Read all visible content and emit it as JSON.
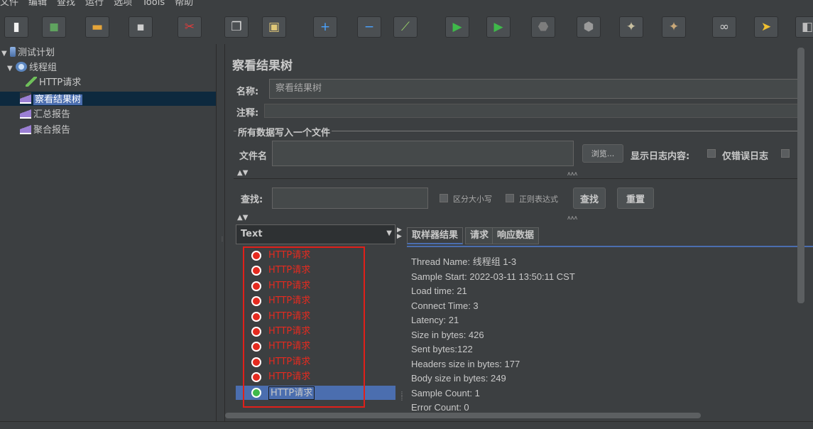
{
  "menu": [
    "文件",
    "编辑",
    "查找",
    "运行",
    "选项",
    "Tools",
    "帮助"
  ],
  "toolbar": {
    "buttons": [
      {
        "name": "new-icon",
        "glyph": "▮",
        "color": "#f2f2f2"
      },
      {
        "name": "templates-icon",
        "glyph": "◼",
        "color": "#5fa35f"
      },
      {
        "name": "open-icon",
        "glyph": "▬",
        "color": "#e5a53a"
      },
      {
        "name": "save-icon",
        "glyph": "▪",
        "color": "#d0d0d0"
      },
      {
        "name": "cut-icon",
        "glyph": "✂",
        "color": "#e03b3b"
      },
      {
        "name": "copy-icon",
        "glyph": "❐",
        "color": "#d8d8d8"
      },
      {
        "name": "paste-icon",
        "glyph": "▣",
        "color": "#e0c878"
      },
      {
        "name": "expand-icon",
        "glyph": "+",
        "color": "#4aa3ff"
      },
      {
        "name": "collapse-icon",
        "glyph": "−",
        "color": "#4aa3ff"
      },
      {
        "name": "toggle-icon",
        "glyph": "⟋",
        "color": "#9ad36a"
      },
      {
        "name": "start-icon",
        "glyph": "▶",
        "color": "#3fb94a"
      },
      {
        "name": "start-no-pauses-icon",
        "glyph": "▶",
        "color": "#3fb94a"
      },
      {
        "name": "stop-icon",
        "glyph": "⬣",
        "color": "#7d7d7d"
      },
      {
        "name": "shutdown-icon",
        "glyph": "⬢",
        "color": "#9a9a9a"
      },
      {
        "name": "clear-icon",
        "glyph": "✦",
        "color": "#c9c0a0"
      },
      {
        "name": "clear-all-icon",
        "glyph": "✦",
        "color": "#c9a878"
      },
      {
        "name": "search-binoculars-icon",
        "glyph": "∞",
        "color": "#d0d0d0"
      },
      {
        "name": "reset-search-icon",
        "glyph": "➤",
        "color": "#f0c030"
      },
      {
        "name": "function-helper-icon",
        "glyph": "◧",
        "color": "#bdbdbd"
      }
    ]
  },
  "tree": {
    "nodes": [
      {
        "label": "测试计划",
        "name": "tree-node-test-plan"
      },
      {
        "label": "线程组",
        "name": "tree-node-thread-group"
      },
      {
        "label": "HTTP请求",
        "name": "tree-node-http-request"
      },
      {
        "label": "察看结果树",
        "name": "tree-node-view-results-tree"
      },
      {
        "label": "汇总报告",
        "name": "tree-node-summary-report"
      },
      {
        "label": "聚合报告",
        "name": "tree-node-aggregate-report"
      }
    ]
  },
  "panel": {
    "title": "察看结果树",
    "name_label": "名称:",
    "name_value": "察看结果树",
    "comment_label": "注释:",
    "file_group_title": "所有数据写入一个文件",
    "filename_label": "文件名",
    "browse_button": "浏览...",
    "log_content_label": "显示日志内容:",
    "errors_only_label": "仅错误日志",
    "search_label": "查找:",
    "case_sensitive_label": "区分大小写",
    "regex_label": "正则表达式",
    "search_button": "查找",
    "reset_button": "重置",
    "renderer_selected": "Text"
  },
  "results": {
    "items": [
      {
        "label": "HTTP请求",
        "status": "fail"
      },
      {
        "label": "HTTP请求",
        "status": "fail"
      },
      {
        "label": "HTTP请求",
        "status": "fail"
      },
      {
        "label": "HTTP请求",
        "status": "fail"
      },
      {
        "label": "HTTP请求",
        "status": "fail"
      },
      {
        "label": "HTTP请求",
        "status": "fail"
      },
      {
        "label": "HTTP请求",
        "status": "fail"
      },
      {
        "label": "HTTP请求",
        "status": "fail"
      },
      {
        "label": "HTTP请求",
        "status": "fail"
      },
      {
        "label": "HTTP请求",
        "status": "ok"
      }
    ]
  },
  "tabs": [
    "取样器结果",
    "请求",
    "响应数据"
  ],
  "details": [
    "Thread Name: 线程组 1-3",
    "Sample Start: 2022-03-11 13:50:11 CST",
    "Load time: 21",
    "Connect Time: 3",
    "Latency: 21",
    "Size in bytes: 426",
    "Sent bytes:122",
    "Headers size in bytes: 177",
    "Body size in bytes: 249",
    "Sample Count: 1",
    "Error Count: 0"
  ],
  "colors": {
    "fail": "#e52a1f",
    "ok": "#3fb94a",
    "highlight": "#e0201a",
    "selection": "#4b6eaf"
  }
}
